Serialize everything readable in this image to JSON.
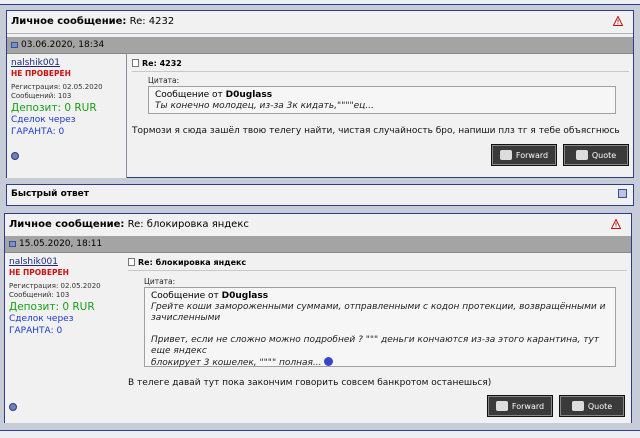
{
  "posts": [
    {
      "title_prefix": "Личное сообщение:",
      "title_subject": "Re: 4232",
      "date": "03.06.2020, 18:34",
      "user": {
        "name": "nalshik001",
        "status": "НЕ ПРОВЕРЕН",
        "reg": "Регистрация: 02.05.2020",
        "msgs": "Сообщений: 103",
        "deposit": "Депозит: 0 RUR",
        "deal_via": "Сделок через",
        "guarantee": "ГАРАНТА: 0"
      },
      "subject": "Re: 4232",
      "quote_label": "Цитата:",
      "quote_from_prefix": "Сообщение от",
      "quote_author": "D0uglass",
      "quote_lines": [
        "Ты конечно молодец, из-за 3к кидать,\"\"\"\"ец..."
      ],
      "message": "Тормози я сюда зашёл твою телегу найти, чистая случайность бро, напиши плз тг я тебе объясгнюсь",
      "forward_label": "Forward",
      "quote_button_label": "Quote"
    },
    {
      "title_prefix": "Личное сообщение:",
      "title_subject": "Re: блокировка яндекс",
      "date": "15.05.2020, 18:11",
      "user": {
        "name": "nalshik001",
        "status": "НЕ ПРОВЕРЕН",
        "reg": "Регистрация: 02.05.2020",
        "msgs": "Сообщений: 103",
        "deposit": "Депозит: 0 RUR",
        "deal_via": "Сделок через",
        "guarantee": "ГАРАНТА: 0"
      },
      "subject": "Re: блокировка яндекс",
      "quote_label": "Цитата:",
      "quote_from_prefix": "Сообщение от",
      "quote_author": "D0uglass",
      "quote_lines": [
        "Грейте коши замороженными суммами, отправленными с кодон протекции, возвращёнными и",
        "зачисленными",
        "",
        "Привет, если не сложно можно подробней ? \"\"\" деньги кончаются из-за этого карантина, тут еще яндекс",
        "блокирует 3 кошелек, \"\"\"\" полная..."
      ],
      "message": "В телеге давай тут пока закончим говорить совсем банкротом останешься)",
      "forward_label": "Forward",
      "quote_button_label": "Quote"
    }
  ],
  "quick_reply": {
    "title": "Быстрый ответ"
  },
  "icons": {
    "warning": "warning-triangle-icon",
    "page": "post-page-icon",
    "status": "offline-status-icon",
    "expand": "expand-icon",
    "smiley": "smiley-icon"
  },
  "colors": {
    "border": "#2c3d8f",
    "date_bar": "#a4a4a4",
    "not_verified": "#d01010",
    "deposit": "#18a018",
    "link_blue": "#1a3ad0"
  }
}
